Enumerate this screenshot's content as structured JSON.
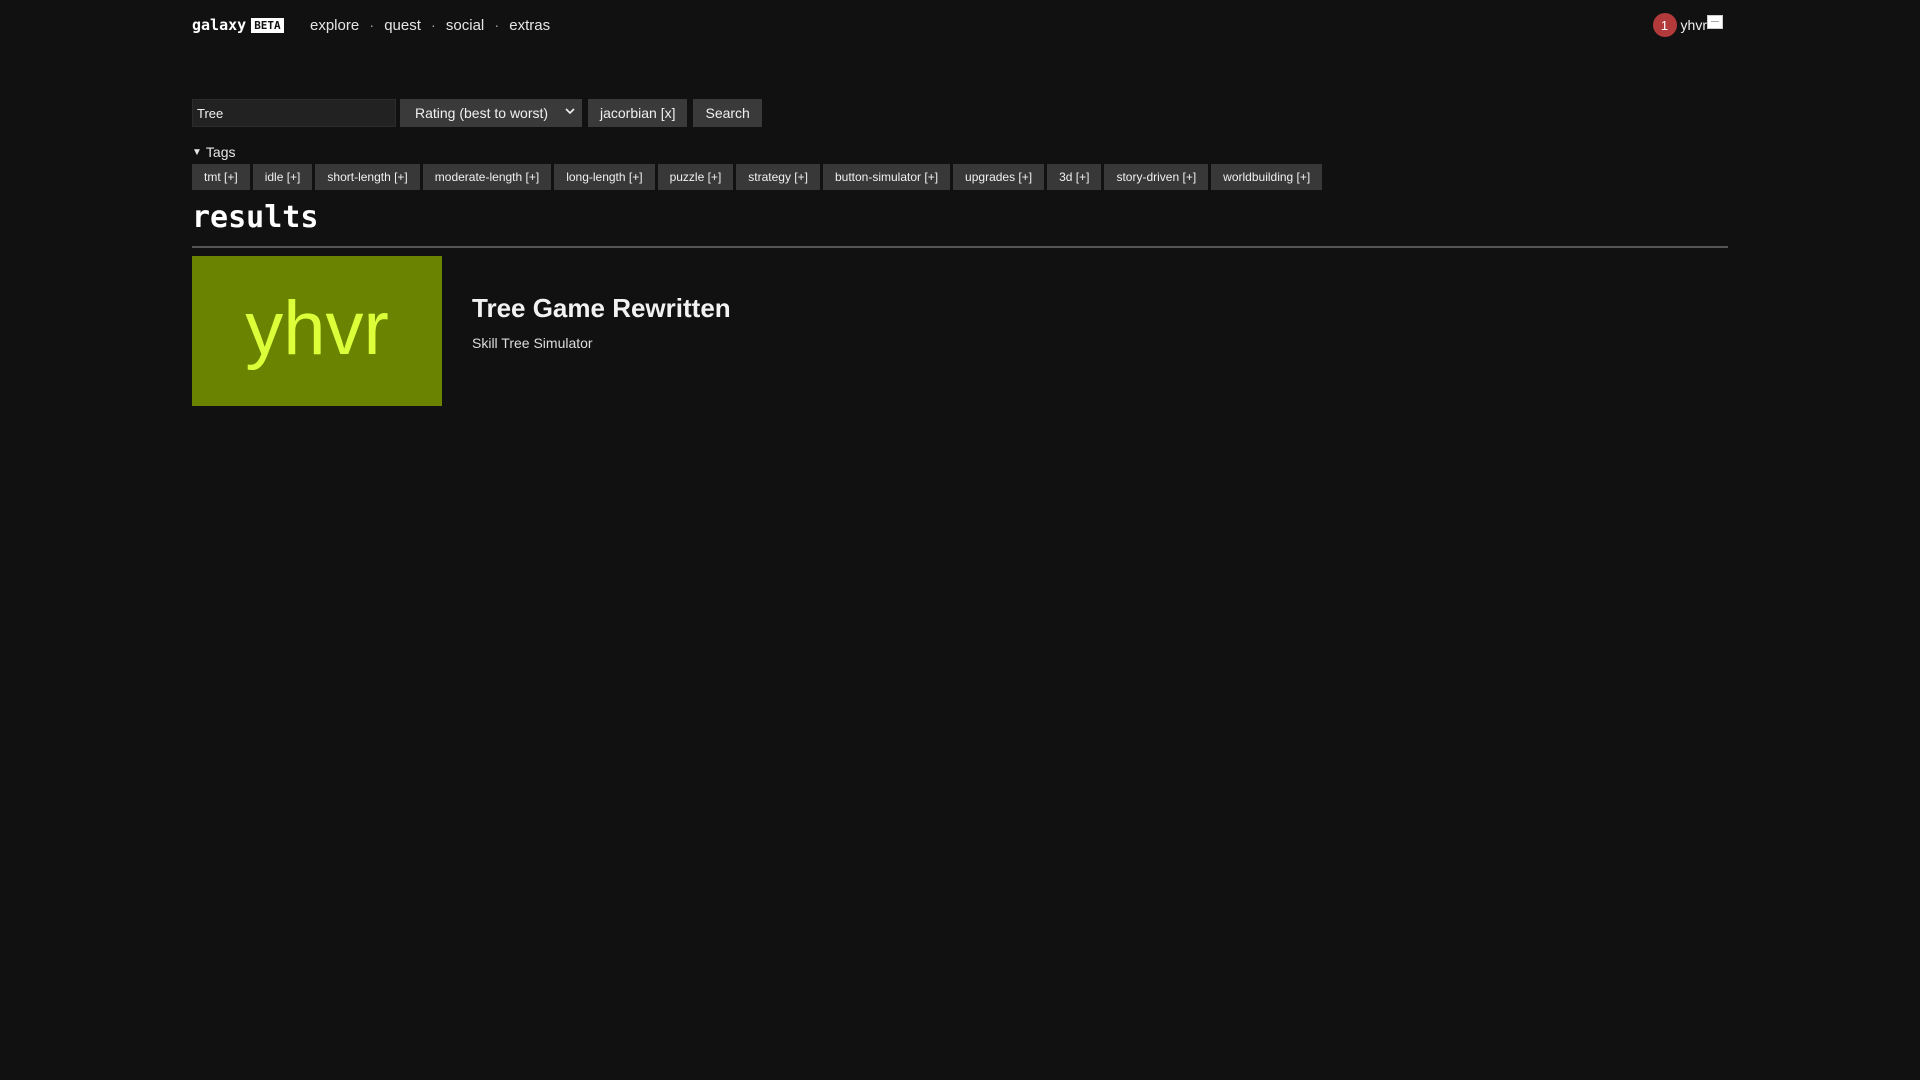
{
  "header": {
    "brand": "galaxy",
    "beta_label": "BETA",
    "nav": [
      {
        "label": "explore"
      },
      {
        "label": "quest"
      },
      {
        "label": "social"
      },
      {
        "label": "extras"
      }
    ],
    "nav_separator": "·",
    "notification_count": "1",
    "username": "yhvr"
  },
  "search": {
    "query": "Tree",
    "sort_selected": "Rating (best to worst)",
    "author_filter_label": "jacorbian [x]",
    "search_button_label": "Search"
  },
  "tags": {
    "summary_label": "Tags",
    "items": [
      {
        "label": "tmt [+]"
      },
      {
        "label": "idle [+]"
      },
      {
        "label": "short-length [+]"
      },
      {
        "label": "moderate-length [+]"
      },
      {
        "label": "long-length [+]"
      },
      {
        "label": "puzzle [+]"
      },
      {
        "label": "strategy [+]"
      },
      {
        "label": "button-simulator [+]"
      },
      {
        "label": "upgrades [+]"
      },
      {
        "label": "3d [+]"
      },
      {
        "label": "story-driven [+]"
      },
      {
        "label": "worldbuilding [+]"
      }
    ]
  },
  "results": {
    "heading": "results",
    "items": [
      {
        "thumb_text": "yhvr",
        "thumb_bg": "#6a8300",
        "thumb_fg": "#dcff3a",
        "title": "Tree Game Rewritten",
        "subtitle": "Skill Tree Simulator"
      }
    ]
  },
  "colors": {
    "background": "#111111",
    "notification": "#b33a3a",
    "control_bg": "#3a3a3a"
  }
}
